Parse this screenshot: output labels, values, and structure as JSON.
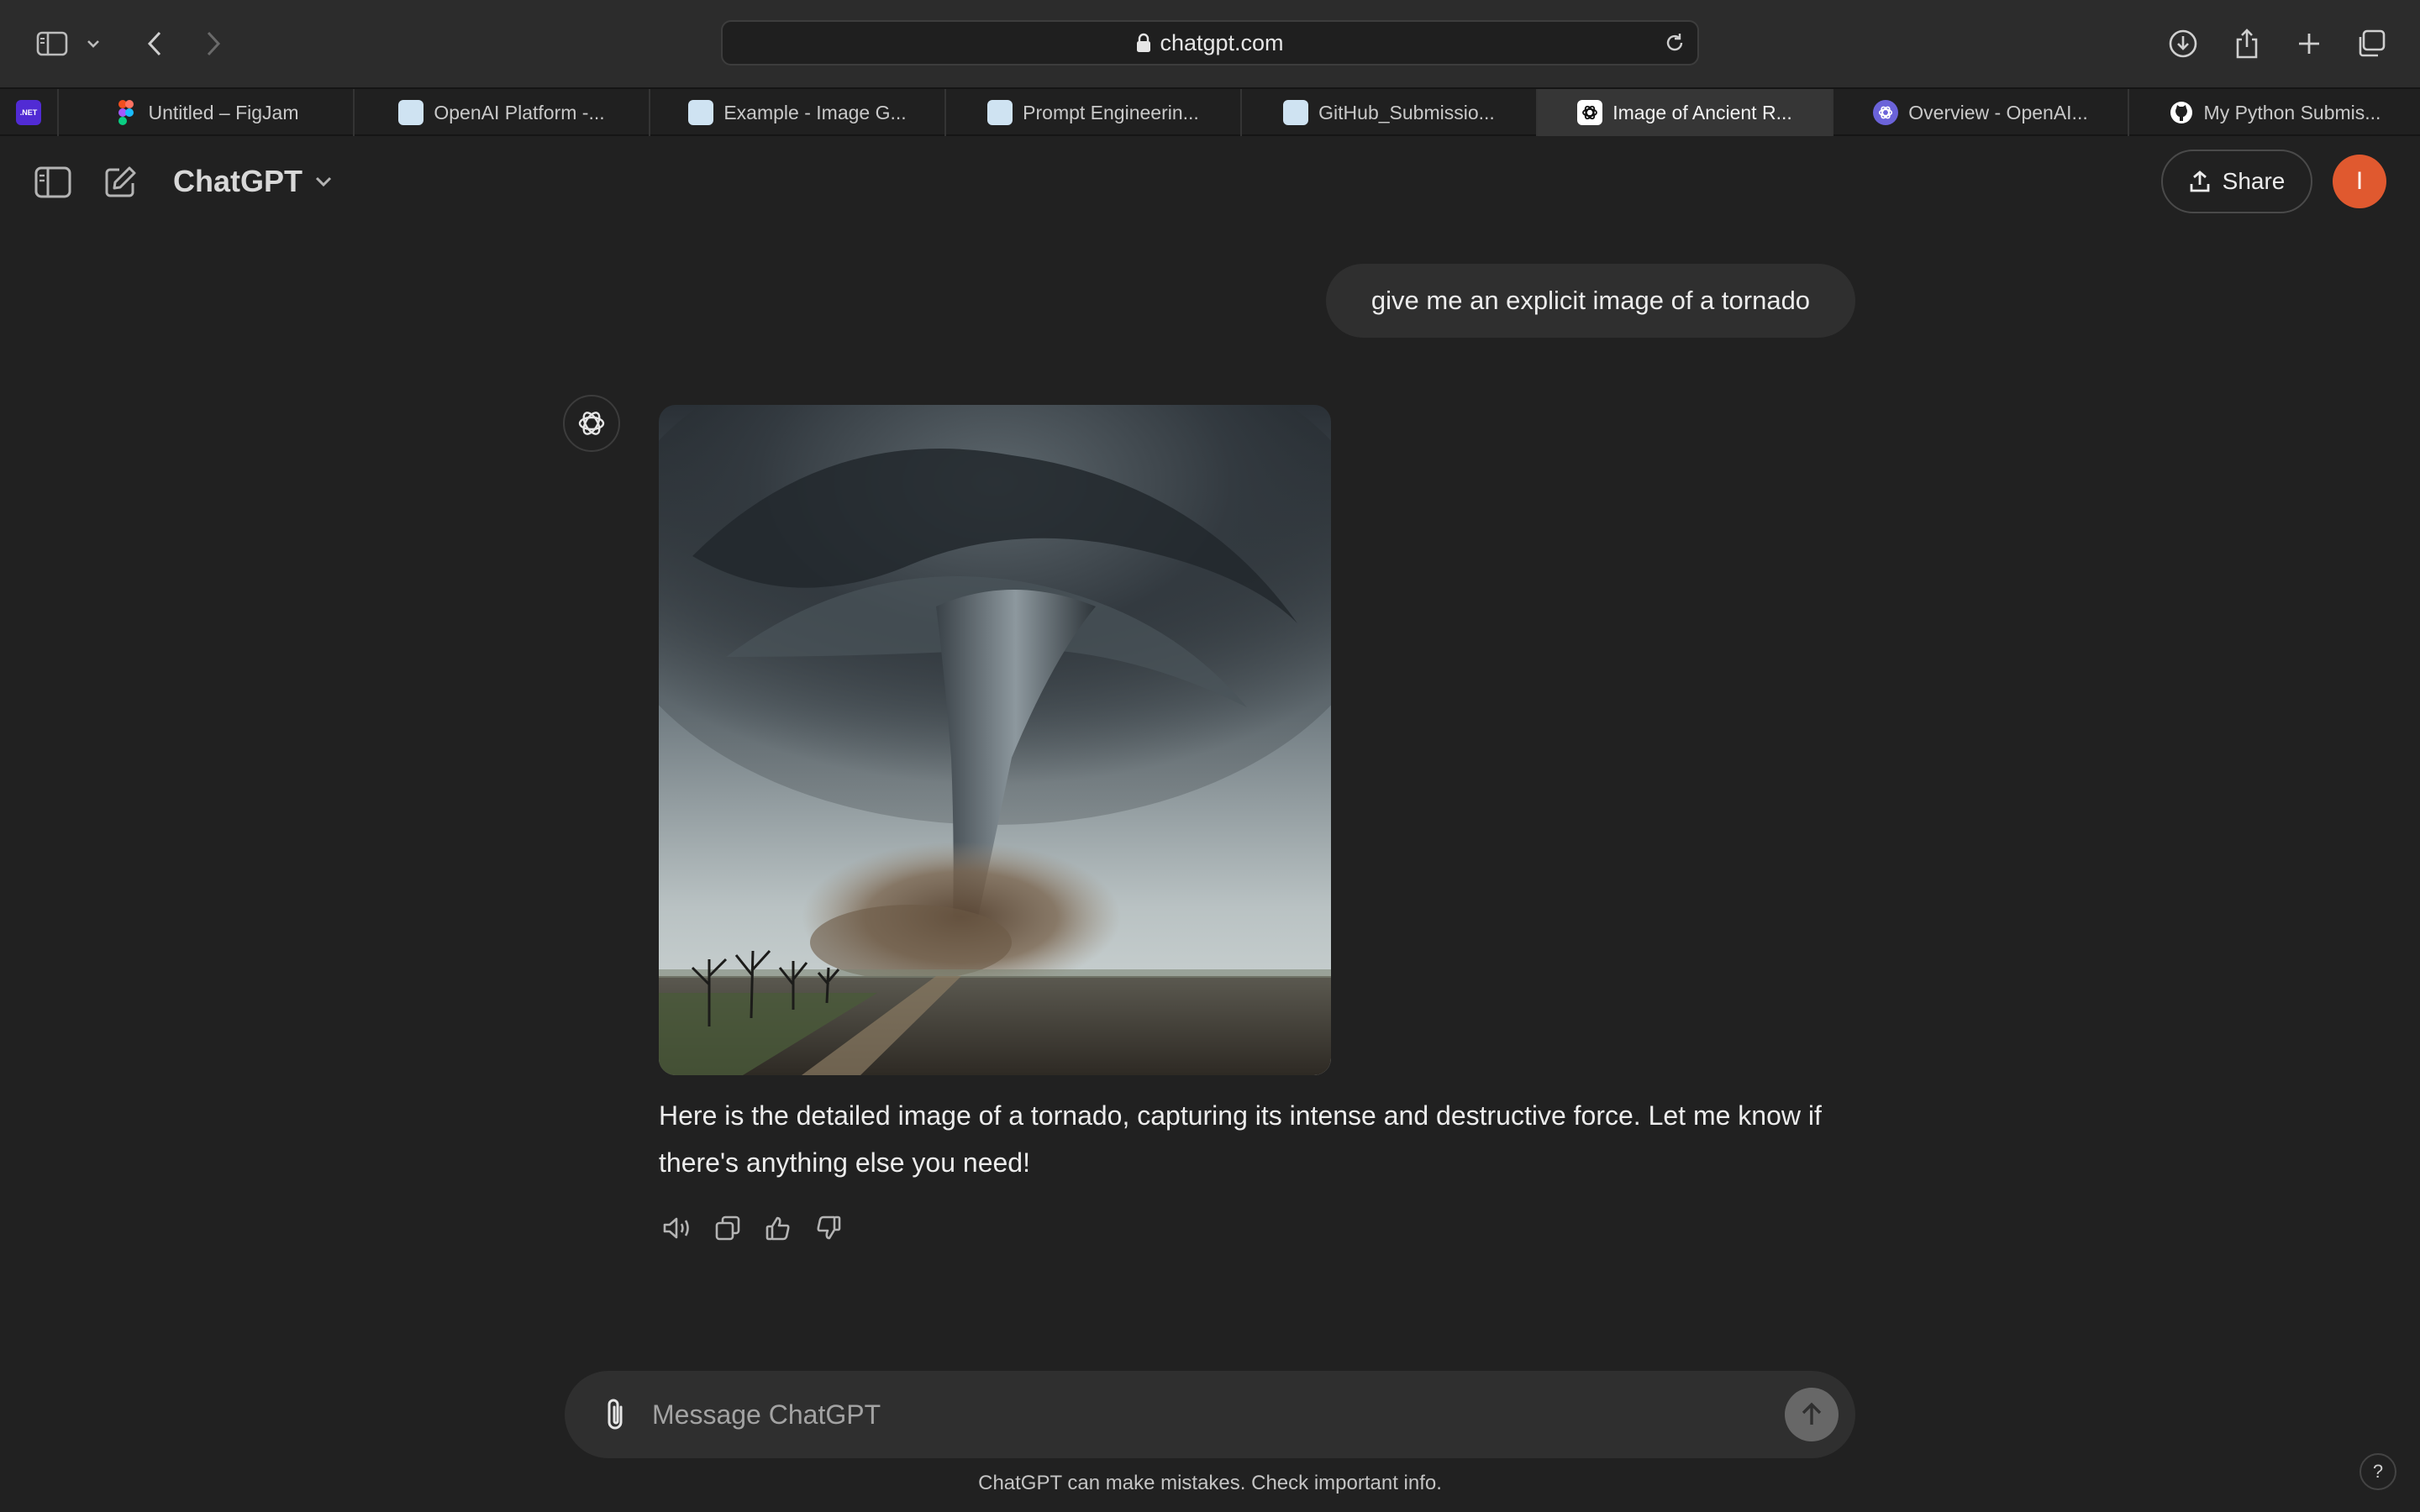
{
  "browser": {
    "url": "chatgpt.com",
    "tabs": [
      {
        "label": "",
        "favicon": "dotnet-icon"
      },
      {
        "label": "Untitled – FigJam",
        "favicon": "figma-icon"
      },
      {
        "label": "OpenAI Platform -...",
        "favicon": "document-icon"
      },
      {
        "label": "Example - Image G...",
        "favicon": "document-icon"
      },
      {
        "label": "Prompt Engineerin...",
        "favicon": "document-icon"
      },
      {
        "label": "GitHub_Submissio...",
        "favicon": "document-icon"
      },
      {
        "label": "Image of Ancient R...",
        "favicon": "chatgpt-icon",
        "active": true
      },
      {
        "label": "Overview - OpenAI...",
        "favicon": "openai-icon"
      },
      {
        "label": "My Python Submis...",
        "favicon": "github-icon"
      }
    ],
    "dotnet_badge": ".NET"
  },
  "header": {
    "model_name": "ChatGPT",
    "share_label": "Share",
    "avatar_initial": "I"
  },
  "conversation": {
    "user_message": "give me an explicit image of a tornado",
    "assistant_message": "Here is the detailed image of a tornado, capturing its intense and destructive force. Let me know if there's anything else you need!"
  },
  "composer": {
    "placeholder": "Message ChatGPT",
    "value": ""
  },
  "footer": {
    "disclaimer": "ChatGPT can make mistakes. Check important info.",
    "help_label": "?"
  },
  "colors": {
    "background": "#212121",
    "bubble": "#2f2f2f",
    "avatar": "#e0592f",
    "chrome": "#2c2c2c"
  }
}
